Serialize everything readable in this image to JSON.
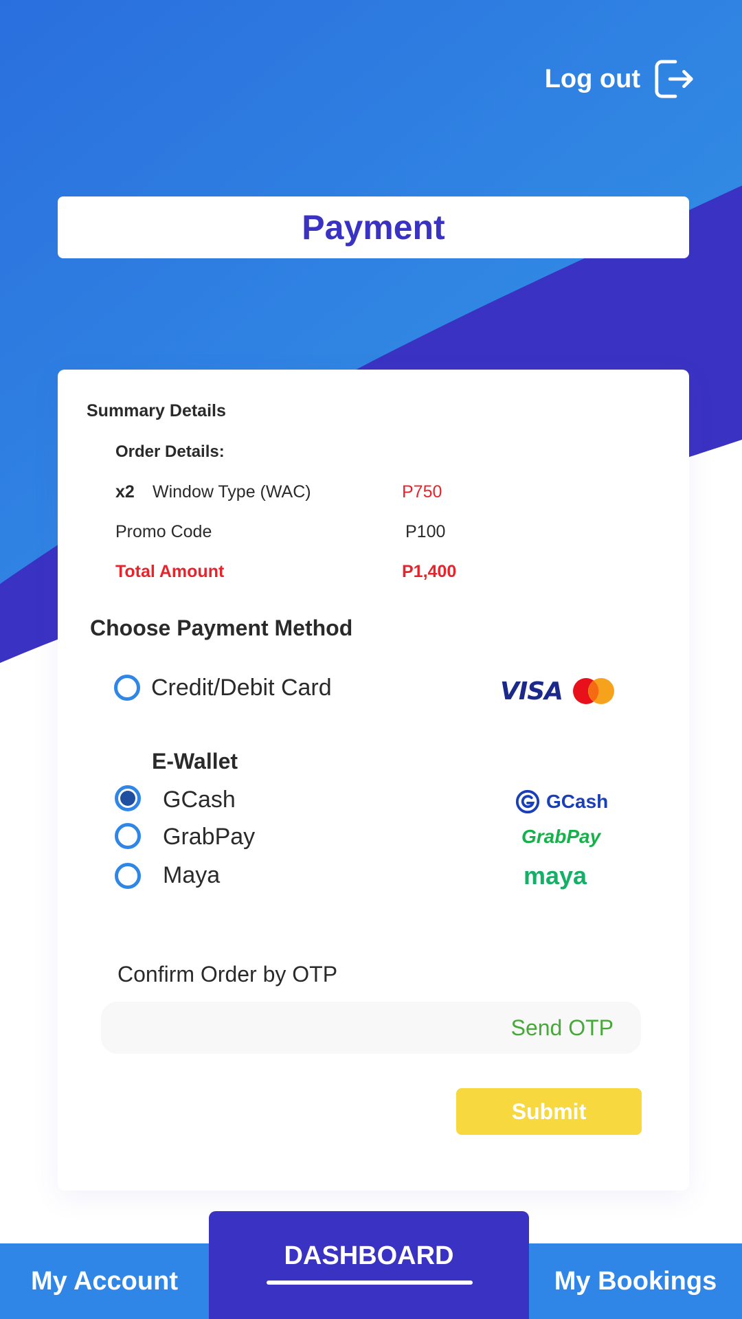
{
  "header": {
    "logout_label": "Log out"
  },
  "page": {
    "title": "Payment"
  },
  "summary": {
    "title": "Summary Details",
    "order_title": "Order Details:",
    "item_qty": "x2",
    "item_name": "Window Type (WAC)",
    "item_price": "P750",
    "promo_label": "Promo Code",
    "promo_value": "P100",
    "total_label": "Total Amount",
    "total_value": "P1,400"
  },
  "payment": {
    "title": "Choose Payment Method",
    "card_label": "Credit/Debit Card",
    "visa_text": "VISA",
    "ewallet_title": "E-Wallet",
    "options": [
      {
        "label": "GCash",
        "brand": "GCash",
        "checked": true
      },
      {
        "label": "GrabPay",
        "brand": "GrabPay",
        "checked": false
      },
      {
        "label": "Maya",
        "brand": "maya",
        "checked": false
      }
    ]
  },
  "otp": {
    "label": "Confirm Order by OTP",
    "send_label": "Send OTP"
  },
  "actions": {
    "submit_label": "Submit"
  },
  "nav": {
    "left": "My Account",
    "center": "DASHBOARD",
    "right": "My Bookings"
  },
  "colors": {
    "primary_blue": "#2f86e6",
    "indigo": "#3a32c2",
    "red": "#e8232a",
    "yellow": "#f7d83e",
    "green": "#47a83a"
  }
}
